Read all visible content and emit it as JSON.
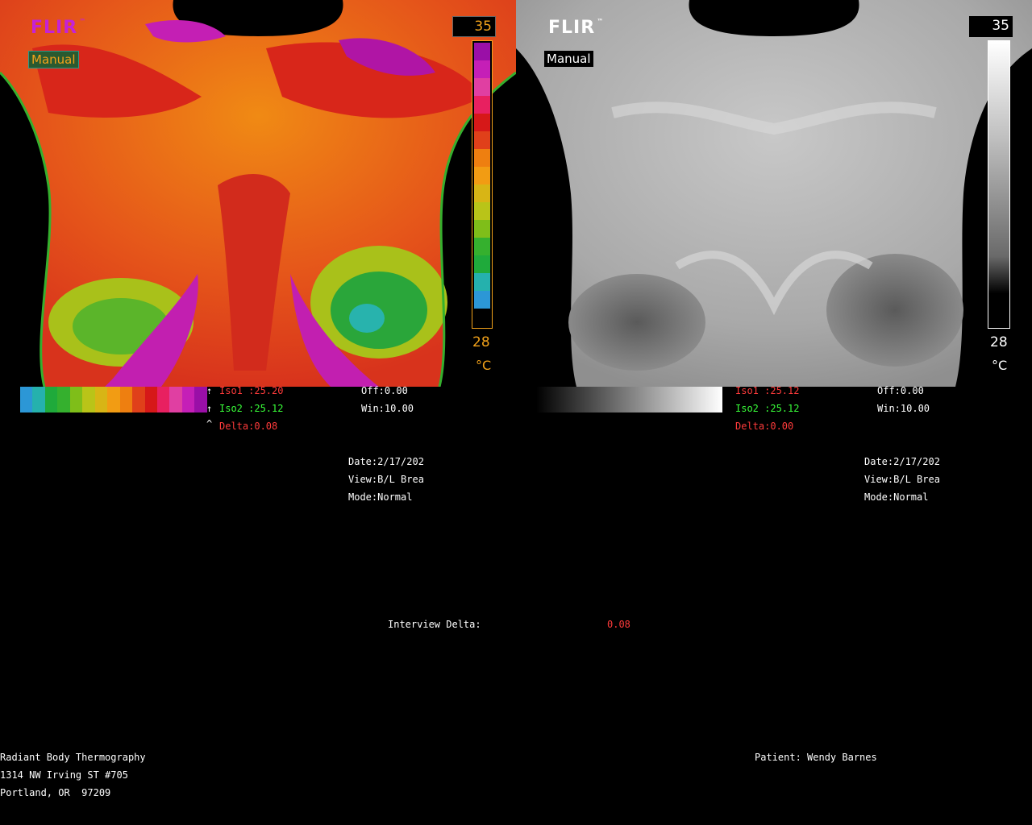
{
  "left_panel": {
    "logo_text": "FLIR",
    "logo_tm": "™",
    "mode_badge": "Manual",
    "scale_max": "35",
    "scale_min": "28",
    "unit": "°C",
    "colors": {
      "palette": [
        "#9a0fa7",
        "#c51fb7",
        "#e03fa2",
        "#e82060",
        "#d61818",
        "#e0401a",
        "#ee7f10",
        "#f29c13",
        "#d8b515",
        "#b9c418",
        "#7fbe19",
        "#35b02e",
        "#1faa3b",
        "#25b1ad",
        "#2c97d6",
        "#000000"
      ]
    },
    "markers": {
      "m1": "⇡",
      "m2": "↑",
      "m3": "^"
    },
    "iso1": "Iso1 :25.20",
    "iso2": "Iso2 :25.12",
    "delta": "Delta:0.08",
    "off": "Off:0.00",
    "win": "Win:10.00",
    "date": "Date:2/17/202",
    "view": "View:B/L Brea",
    "mode": "Mode:Normal"
  },
  "right_panel": {
    "logo_text": "FLIR",
    "logo_tm": "™",
    "mode_badge": "Manual",
    "scale_max": "35",
    "scale_min": "28",
    "unit": "°C",
    "iso1": "Iso1 :25.12",
    "iso2": "Iso2 :25.12",
    "delta": "Delta:0.00",
    "off": "Off:0.00",
    "win": "Win:10.00",
    "date": "Date:2/17/202",
    "view": "View:B/L Brea",
    "mode": "Mode:Normal"
  },
  "interview": {
    "label": "Interview Delta:",
    "value": "0.08"
  },
  "clinic": {
    "name": "Radiant Body Thermography",
    "address1": "1314 NW Irving ST #705",
    "address2": "Portland, OR  97209"
  },
  "patient": {
    "label": "Patient: Wendy Barnes"
  }
}
